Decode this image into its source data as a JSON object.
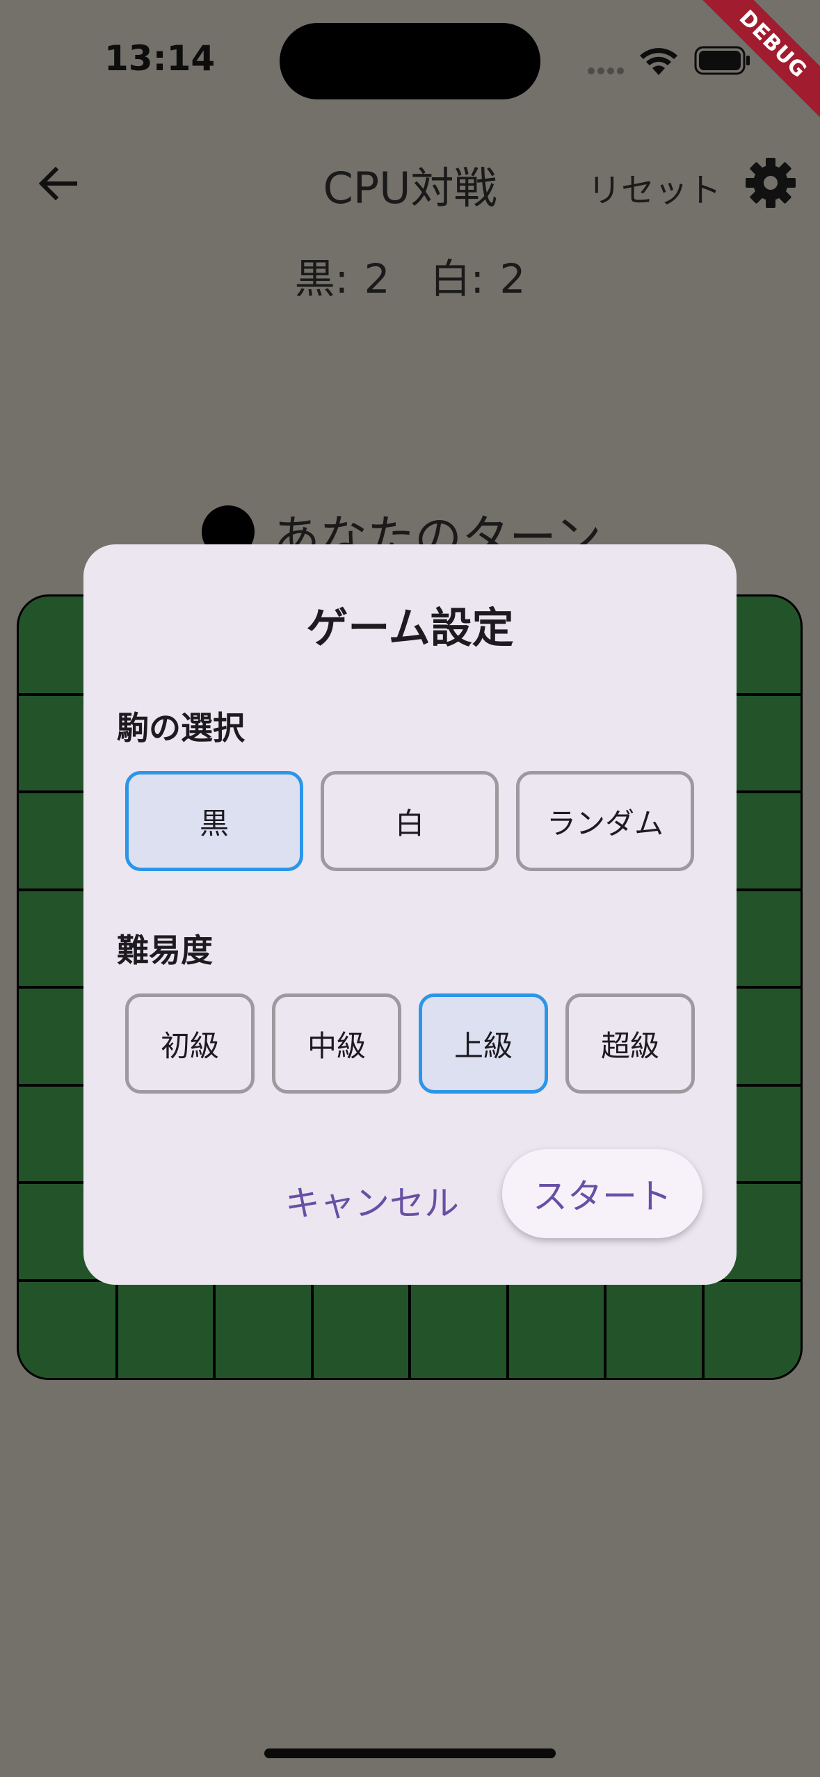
{
  "status_bar": {
    "time": "13:14",
    "debug_label": "DEBUG"
  },
  "app_bar": {
    "title": "CPU対戦",
    "reset_label": "リセット"
  },
  "score": {
    "text": "黒: 2　白: 2",
    "black": 2,
    "white": 2
  },
  "turn": {
    "text": "あなたのターン"
  },
  "dialog": {
    "title": "ゲーム設定",
    "piece_section": {
      "label": "駒の選択",
      "options": [
        "黒",
        "白",
        "ランダム"
      ],
      "selected": "黒"
    },
    "difficulty_section": {
      "label": "難易度",
      "options": [
        "初級",
        "中級",
        "上級",
        "超級"
      ],
      "selected": "上級"
    },
    "cancel_label": "キャンセル",
    "start_label": "スタート"
  },
  "colors": {
    "scrim_background": "#74716b",
    "board_green": "#235429",
    "dialog_background": "#ece6f0",
    "selected_border": "#2b95e9",
    "selected_fill": "#dde0f1",
    "accent_text": "#6750a4"
  },
  "icons": [
    "back-arrow-icon",
    "gear-icon",
    "wifi-icon",
    "battery-icon"
  ]
}
